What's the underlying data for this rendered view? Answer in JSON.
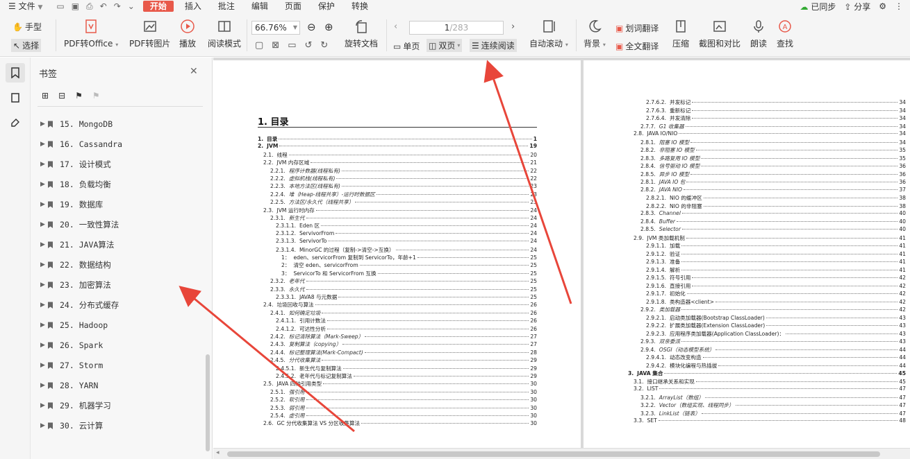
{
  "menubar": {
    "file": "文件",
    "tabs": [
      "开始",
      "插入",
      "批注",
      "编辑",
      "页面",
      "保护",
      "转换"
    ],
    "active_tab": "开始",
    "sync": "已同步",
    "share": "分享"
  },
  "toolbar": {
    "hand": "手型",
    "select": "选择",
    "pdf_to_office": "PDF转Office",
    "pdf_to_image": "PDF转图片",
    "play": "播放",
    "read_mode": "阅读模式",
    "zoom": "66.76%",
    "page_current": "1",
    "page_total": "/283",
    "rotate": "旋转文档",
    "single": "单页",
    "double": "双页",
    "continuous": "连续阅读",
    "auto_scroll": "自动滚动",
    "background": "背景",
    "translate_words": "划词翻译",
    "translate_all": "全文翻译",
    "compress": "压缩",
    "screenshot": "截图和对比",
    "read_aloud": "朗读",
    "find": "查找"
  },
  "panel": {
    "title": "书签",
    "items": [
      {
        "num": "15.",
        "label": "MongoDB"
      },
      {
        "num": "16.",
        "label": "Cassandra"
      },
      {
        "num": "17.",
        "label": "设计模式"
      },
      {
        "num": "18.",
        "label": "负载均衡"
      },
      {
        "num": "19.",
        "label": "数据库"
      },
      {
        "num": "20.",
        "label": "一致性算法"
      },
      {
        "num": "21.",
        "label": "JAVA算法"
      },
      {
        "num": "22.",
        "label": "数据结构"
      },
      {
        "num": "23.",
        "label": "加密算法"
      },
      {
        "num": "24.",
        "label": "分布式缓存"
      },
      {
        "num": "25.",
        "label": "Hadoop"
      },
      {
        "num": "26.",
        "label": "Spark"
      },
      {
        "num": "27.",
        "label": "Storm"
      },
      {
        "num": "28.",
        "label": "YARN"
      },
      {
        "num": "29.",
        "label": "机器学习"
      },
      {
        "num": "30.",
        "label": "云计算"
      }
    ]
  },
  "doc": {
    "title": "1. 目录",
    "left": [
      {
        "n": "1.",
        "t": "目录",
        "p": "1",
        "s": "b",
        "ind": 0
      },
      {
        "n": "2.",
        "t": "JVM",
        "p": "19",
        "s": "b",
        "ind": 0
      },
      {
        "n": "2.1.",
        "t": "线程",
        "p": "20",
        "s": "",
        "ind": 8
      },
      {
        "n": "2.2.",
        "t": "JVM 内存区域",
        "p": "21",
        "s": "",
        "ind": 8
      },
      {
        "n": "2.2.1.",
        "t": "程序计数器(线程私有)",
        "p": "22",
        "s": "i",
        "ind": 18
      },
      {
        "n": "2.2.2.",
        "t": "虚拟机栈(线程私有)",
        "p": "22",
        "s": "i",
        "ind": 18
      },
      {
        "n": "2.2.3.",
        "t": "本地方法区(线程私有)",
        "p": "23",
        "s": "i",
        "ind": 18
      },
      {
        "n": "2.2.4.",
        "t": "堆（Heap-线程共享）-运行时数据区",
        "p": "23",
        "s": "i",
        "ind": 18
      },
      {
        "n": "2.2.5.",
        "t": "方法区/永久代（线程共享）",
        "p": "23",
        "s": "i",
        "ind": 18
      },
      {
        "n": "2.3.",
        "t": "JVM 运行时内存",
        "p": "24",
        "s": "",
        "ind": 8
      },
      {
        "n": "2.3.1.",
        "t": "新生代",
        "p": "24",
        "s": "i",
        "ind": 18
      },
      {
        "n": "2.3.1.1.",
        "t": "Eden 区",
        "p": "24",
        "s": "",
        "ind": 26
      },
      {
        "n": "2.3.1.2.",
        "t": "ServivorFrom",
        "p": "24",
        "s": "",
        "ind": 26
      },
      {
        "n": "2.3.1.3.",
        "t": "ServivorTo",
        "p": "24",
        "s": "",
        "ind": 26
      },
      {
        "n": "2.3.1.4.",
        "t": "MinorGC 的过程（复制->清空->互换）",
        "p": "24",
        "s": "",
        "ind": 26
      },
      {
        "n": "1：",
        "t": "eden、servicorFrom 复制到 ServicorTo，年龄+1",
        "p": "25",
        "s": "",
        "ind": 34
      },
      {
        "n": "2：",
        "t": "清空 eden、servicorFrom",
        "p": "25",
        "s": "",
        "ind": 34
      },
      {
        "n": "3：",
        "t": "ServicorTo 和 ServicorFrom 互换",
        "p": "25",
        "s": "",
        "ind": 34
      },
      {
        "n": "2.3.2.",
        "t": "老年代",
        "p": "25",
        "s": "i",
        "ind": 18
      },
      {
        "n": "2.3.3.",
        "t": "永久代",
        "p": "25",
        "s": "i",
        "ind": 18
      },
      {
        "n": "2.3.3.1.",
        "t": "JAVA8 与元数据",
        "p": "25",
        "s": "",
        "ind": 26
      },
      {
        "n": "2.4.",
        "t": "垃圾回收与算法",
        "p": "26",
        "s": "",
        "ind": 8
      },
      {
        "n": "2.4.1.",
        "t": "如何确定垃圾",
        "p": "26",
        "s": "i",
        "ind": 18
      },
      {
        "n": "2.4.1.1.",
        "t": "引用计数法",
        "p": "26",
        "s": "",
        "ind": 26
      },
      {
        "n": "2.4.1.2.",
        "t": "可达性分析",
        "p": "26",
        "s": "",
        "ind": 26
      },
      {
        "n": "2.4.2.",
        "t": "标记清除算法（Mark-Sweep）",
        "p": "27",
        "s": "i",
        "ind": 18
      },
      {
        "n": "2.4.3.",
        "t": "复制算法（copying）",
        "p": "27",
        "s": "i",
        "ind": 18
      },
      {
        "n": "2.4.4.",
        "t": "标记整理算法(Mark-Compact)",
        "p": "28",
        "s": "i",
        "ind": 18
      },
      {
        "n": "2.4.5.",
        "t": "分代收集算法",
        "p": "29",
        "s": "i",
        "ind": 18
      },
      {
        "n": "2.4.5.1.",
        "t": "新生代与复制算法",
        "p": "29",
        "s": "",
        "ind": 26
      },
      {
        "n": "2.4.5.2.",
        "t": "老年代与标记复制算法",
        "p": "29",
        "s": "",
        "ind": 26
      },
      {
        "n": "2.5.",
        "t": "JAVA 四种引用类型",
        "p": "30",
        "s": "",
        "ind": 8
      },
      {
        "n": "2.5.1.",
        "t": "强引用",
        "p": "30",
        "s": "i",
        "ind": 18
      },
      {
        "n": "2.5.2.",
        "t": "软引用",
        "p": "30",
        "s": "i",
        "ind": 18
      },
      {
        "n": "2.5.3.",
        "t": "弱引用",
        "p": "30",
        "s": "i",
        "ind": 18
      },
      {
        "n": "2.5.4.",
        "t": "虚引用",
        "p": "30",
        "s": "i",
        "ind": 18
      },
      {
        "n": "2.6.",
        "t": "GC 分代收集算法  VS 分区收集算法",
        "p": "30",
        "s": "",
        "ind": 8
      }
    ],
    "right": [
      {
        "n": "2.7.6.2.",
        "t": "并发标记",
        "p": "34",
        "s": "",
        "ind": 26
      },
      {
        "n": "2.7.6.3.",
        "t": "重新标记",
        "p": "34",
        "s": "",
        "ind": 26
      },
      {
        "n": "2.7.6.4.",
        "t": "并发清除",
        "p": "34",
        "s": "",
        "ind": 26
      },
      {
        "n": "2.7.7.",
        "t": "G1 收集器",
        "p": "34",
        "s": "i",
        "ind": 18
      },
      {
        "n": "2.8.",
        "t": "JAVA IO/NIO",
        "p": "34",
        "s": "",
        "ind": 8
      },
      {
        "n": "2.8.1.",
        "t": "阻塞 IO 模型",
        "p": "34",
        "s": "i",
        "ind": 18
      },
      {
        "n": "2.8.2.",
        "t": "非阻塞 IO 模型",
        "p": "35",
        "s": "i",
        "ind": 18
      },
      {
        "n": "2.8.3.",
        "t": "多路复用 IO 模型",
        "p": "35",
        "s": "i",
        "ind": 18
      },
      {
        "n": "2.8.4.",
        "t": "信号驱动 IO 模型",
        "p": "36",
        "s": "i",
        "ind": 18
      },
      {
        "n": "2.8.5.",
        "t": "异步 IO 模型",
        "p": "36",
        "s": "i",
        "ind": 18
      },
      {
        "n": "2.8.1.",
        "t": "JAVA IO 包",
        "p": "36",
        "s": "i",
        "ind": 18
      },
      {
        "n": "2.8.2.",
        "t": "JAVA NIO",
        "p": "37",
        "s": "i",
        "ind": 18
      },
      {
        "n": "2.8.2.1.",
        "t": "NIO 的缓冲区",
        "p": "38",
        "s": "",
        "ind": 26
      },
      {
        "n": "2.8.2.2.",
        "t": "NIO 的非阻塞",
        "p": "38",
        "s": "",
        "ind": 26
      },
      {
        "n": "2.8.3.",
        "t": "Channel",
        "p": "40",
        "s": "i",
        "ind": 18
      },
      {
        "n": "2.8.4.",
        "t": "Buffer",
        "p": "40",
        "s": "i",
        "ind": 18
      },
      {
        "n": "2.8.5.",
        "t": "Selector",
        "p": "40",
        "s": "i",
        "ind": 18
      },
      {
        "n": "2.9.",
        "t": "JVM 类加载机制",
        "p": "41",
        "s": "",
        "ind": 8
      },
      {
        "n": "2.9.1.1.",
        "t": "加载",
        "p": "41",
        "s": "",
        "ind": 26
      },
      {
        "n": "2.9.1.2.",
        "t": "验证",
        "p": "41",
        "s": "",
        "ind": 26
      },
      {
        "n": "2.9.1.3.",
        "t": "准备",
        "p": "41",
        "s": "",
        "ind": 26
      },
      {
        "n": "2.9.1.4.",
        "t": "解析",
        "p": "41",
        "s": "",
        "ind": 26
      },
      {
        "n": "2.9.1.5.",
        "t": "符号引用",
        "p": "42",
        "s": "",
        "ind": 26
      },
      {
        "n": "2.9.1.6.",
        "t": "直接引用",
        "p": "42",
        "s": "",
        "ind": 26
      },
      {
        "n": "2.9.1.7.",
        "t": "初始化",
        "p": "42",
        "s": "",
        "ind": 26
      },
      {
        "n": "2.9.1.8.",
        "t": "类构造器<client>",
        "p": "42",
        "s": "",
        "ind": 26
      },
      {
        "n": "2.9.2.",
        "t": "类加载器",
        "p": "42",
        "s": "i",
        "ind": 18
      },
      {
        "n": "2.9.2.1.",
        "t": "启动类加载器(Bootstrap ClassLoader)",
        "p": "43",
        "s": "",
        "ind": 26
      },
      {
        "n": "2.9.2.2.",
        "t": "扩展类加载器(Extension ClassLoader)",
        "p": "43",
        "s": "",
        "ind": 26
      },
      {
        "n": "2.9.2.3.",
        "t": "应用程序类加载器(Application ClassLoader)：",
        "p": "43",
        "s": "",
        "ind": 26
      },
      {
        "n": "2.9.3.",
        "t": "双亲委派",
        "p": "43",
        "s": "i",
        "ind": 18
      },
      {
        "n": "2.9.4.",
        "t": "OSGI（动态模型系统）",
        "p": "44",
        "s": "i",
        "ind": 18
      },
      {
        "n": "2.9.4.1.",
        "t": "动态改变构造",
        "p": "44",
        "s": "",
        "ind": 26
      },
      {
        "n": "2.9.4.2.",
        "t": "模块化编程与热插拔",
        "p": "44",
        "s": "",
        "ind": 26
      },
      {
        "n": "3.",
        "t": "JAVA 集合",
        "p": "45",
        "s": "b",
        "ind": 0
      },
      {
        "n": "3.1.",
        "t": "接口继承关系和实现",
        "p": "45",
        "s": "",
        "ind": 8
      },
      {
        "n": "3.2.",
        "t": "LIST",
        "p": "47",
        "s": "",
        "ind": 8
      },
      {
        "n": "3.2.1.",
        "t": "ArrayList（数组）",
        "p": "47",
        "s": "i",
        "ind": 18
      },
      {
        "n": "3.2.2.",
        "t": "Vector（数组实现、线程同步）",
        "p": "47",
        "s": "i",
        "ind": 18
      },
      {
        "n": "3.2.3.",
        "t": "LinkList（链表）",
        "p": "47",
        "s": "i",
        "ind": 18
      },
      {
        "n": "3.3.",
        "t": "SET",
        "p": "48",
        "s": "",
        "ind": 8
      }
    ]
  },
  "colors": {
    "accent": "#e8594a",
    "arrow": "#e8463a"
  }
}
